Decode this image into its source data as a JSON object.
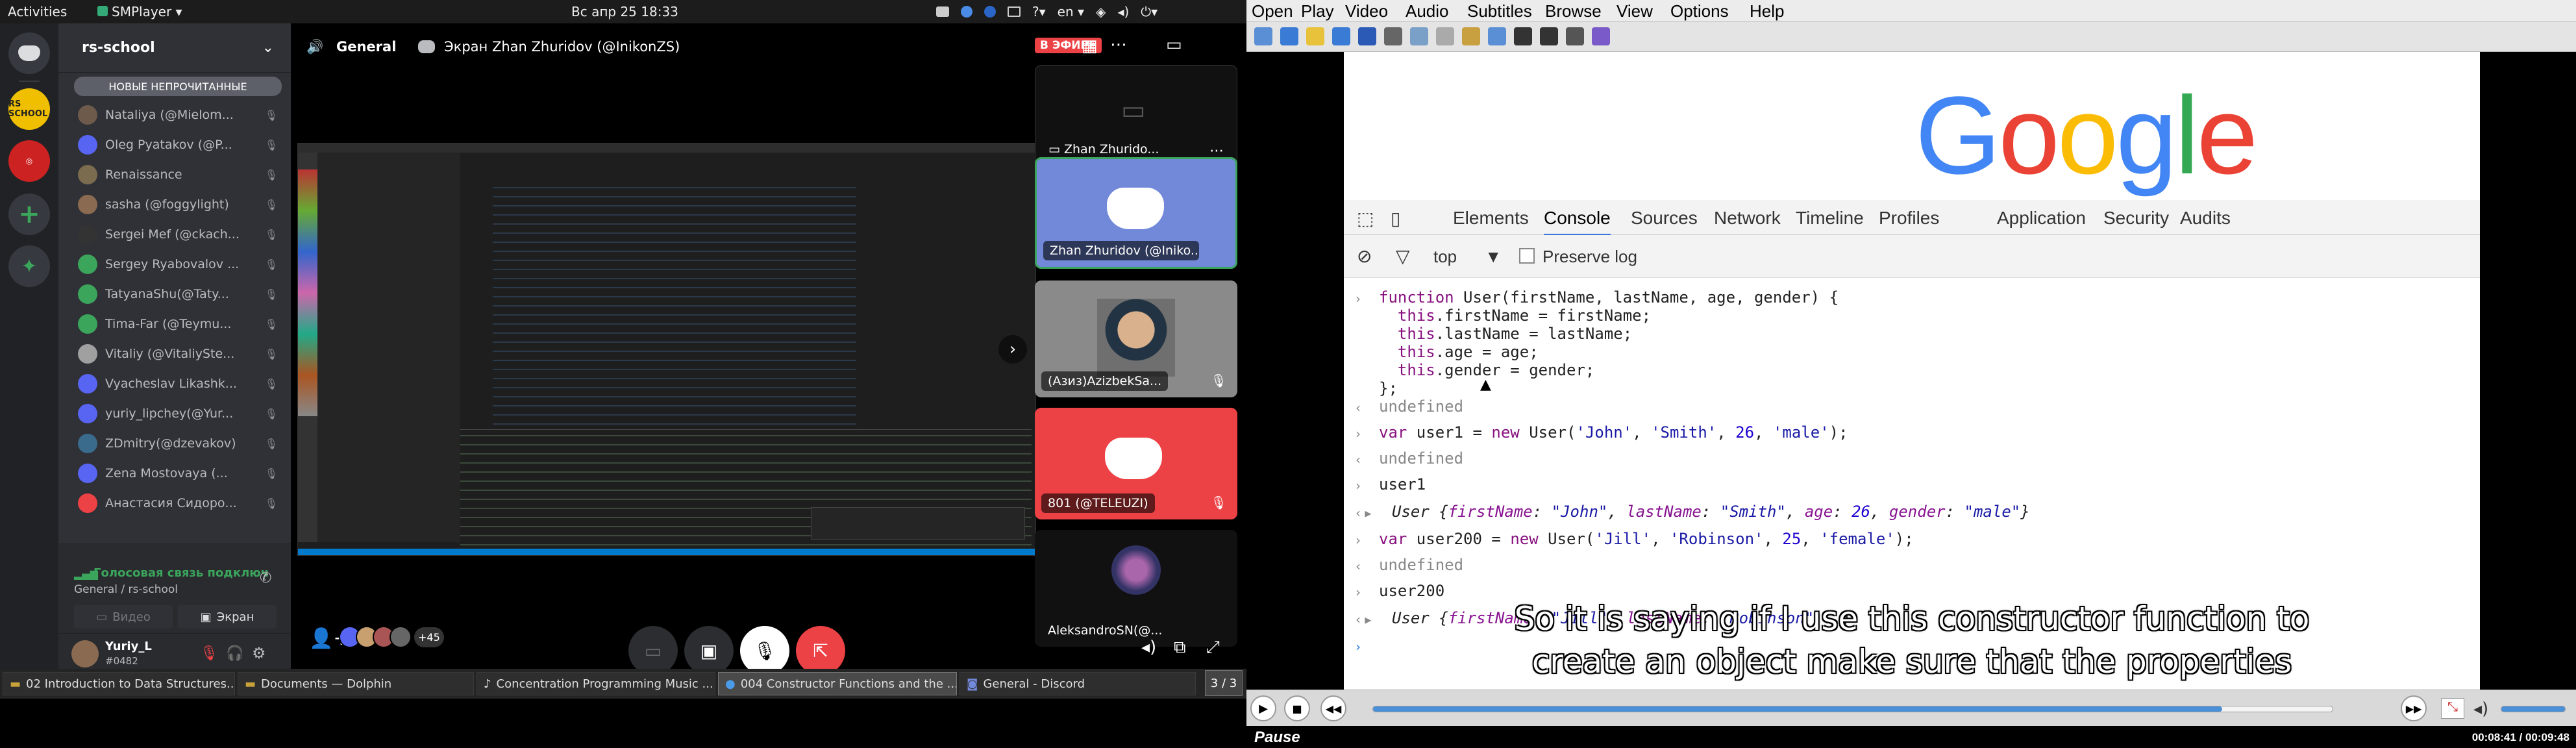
{
  "topbar": {
    "activities": "Activities",
    "app": "SMPlayer",
    "clock": "Вс апр 25  18:33",
    "lang": "en"
  },
  "discord": {
    "server_name": "rs-school",
    "new_unread": "НОВЫЕ НЕПРОЧИТАННЫЕ",
    "members": [
      {
        "name": "Nataliya (@Mielom...",
        "color": "#6d5a4a"
      },
      {
        "name": "Oleg Pyatakov (@P...",
        "color": "#5865f2"
      },
      {
        "name": "Renaissance",
        "color": "#7b6b4f"
      },
      {
        "name": "sasha (@foggylight)",
        "color": "#8a6a50"
      },
      {
        "name": "Sergei Mef (@ckach...",
        "color": "#333333"
      },
      {
        "name": "Sergey Ryabovalov ...",
        "color": "#3ba55c"
      },
      {
        "name": "TatyanaShu(@Taty...",
        "color": "#3ba55c"
      },
      {
        "name": "Tima-Far (@Teymu...",
        "color": "#3ba55c"
      },
      {
        "name": "Vitaliy (@VitaliySte...",
        "color": "#a0a0a0"
      },
      {
        "name": "Vyacheslav Likashk...",
        "color": "#5865f2"
      },
      {
        "name": "yuriy_lipchey(@Yur...",
        "color": "#5865f2"
      },
      {
        "name": "ZDmitry(@dzevakov)",
        "color": "#3a6b8c"
      },
      {
        "name": "Zena Mostovaya (...",
        "color": "#5865f2"
      },
      {
        "name": "Анастасия Сидоро...",
        "color": "#ed4245"
      }
    ],
    "voice_connected": "Голосовая связь подключ",
    "voice_channel": "General / rs-school",
    "video_btn": "Видео",
    "screen_btn": "Экран",
    "user_name": "Yuriy_L",
    "user_tag": "#0482",
    "stage_channel": "General",
    "stage_screen": "Экран Zhan Zhuridov (@InikonZS)",
    "live_badge": "В ЭФИРЕ",
    "tiles": [
      {
        "label": "Zhan Zhurido..."
      },
      {
        "label": "Zhan Zhuridov (@Iniko..."
      },
      {
        "label": "(Азиз)AzizbekSa..."
      },
      {
        "label": "801 (@TELEUZI)"
      },
      {
        "label": "AleksandroSN(@..."
      }
    ],
    "plus_count": "+45",
    "page_counter": "3 / 3"
  },
  "taskbar": [
    {
      "label": "02 Introduction to Data Structures..."
    },
    {
      "label": "Documents — Dolphin"
    },
    {
      "label": "Concentration Programming Music ..."
    },
    {
      "label": "004 Constructor Functions and the ..."
    },
    {
      "label": "General - Discord"
    }
  ],
  "smplayer": {
    "menu": [
      "Open",
      "Play",
      "Video",
      "Audio",
      "Subtitles",
      "Browse",
      "View",
      "Options",
      "Help"
    ],
    "devtools_tabs": [
      "Elements",
      "Console",
      "Sources",
      "Network",
      "Timeline",
      "Profiles",
      "Application",
      "Security",
      "Audits"
    ],
    "filter_top": "top",
    "preserve_log": "Preserve log",
    "subtitle_line1": "So it is saying if I use this constructor function to",
    "subtitle_line2": "create an object make sure that the properties",
    "status_left": "Pause",
    "status_time": "00:08:41 / 00:09:48",
    "seek_progress": 0.885,
    "colors": {
      "google_blue": "#4285f4",
      "google_red": "#ea4335",
      "google_yellow": "#fbbc05",
      "google_green": "#34a853"
    },
    "google_letters": [
      "G",
      "o",
      "o",
      "g",
      "l",
      "e"
    ]
  }
}
